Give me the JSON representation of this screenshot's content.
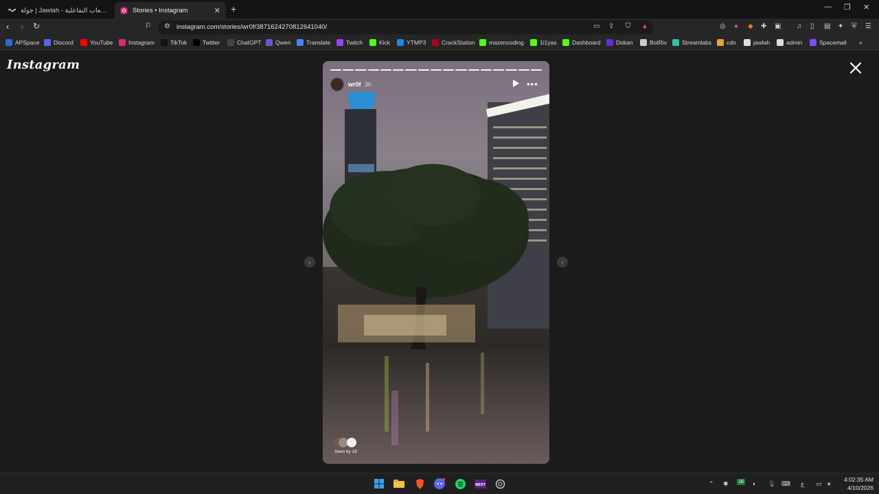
{
  "browser": {
    "tabs": [
      {
        "title": "جولة | Jawlah - منصة الألعاب التفاعلية",
        "favicon": "jawlah-icon",
        "active": false
      },
      {
        "title": "Stories • Instagram",
        "favicon": "instagram-icon",
        "active": true
      }
    ],
    "new_tab_label": "+",
    "url": "instagram.com/stories/wr0f/3871624270812641040/",
    "bookmarks": [
      {
        "label": "APSpace",
        "icon": "apspace-icon",
        "color": "#2b6cd4"
      },
      {
        "label": "Discord",
        "icon": "discord-icon",
        "color": "#5865f2"
      },
      {
        "label": "YouTube",
        "icon": "youtube-icon",
        "color": "#ff0000"
      },
      {
        "label": "Instagram",
        "icon": "instagram-icon",
        "color": "#d62976"
      },
      {
        "label": "TikTok",
        "icon": "tiktok-icon",
        "color": "#111111"
      },
      {
        "label": "Twitter",
        "icon": "x-icon",
        "color": "#000000"
      },
      {
        "label": "ChatGPT",
        "icon": "chatgpt-icon",
        "color": "#444444"
      },
      {
        "label": "Qwen",
        "icon": "qwen-icon",
        "color": "#6e56cf"
      },
      {
        "label": "Translate",
        "icon": "translate-icon",
        "color": "#4285f4"
      },
      {
        "label": "Twitch",
        "icon": "twitch-icon",
        "color": "#9146ff"
      },
      {
        "label": "Kick",
        "icon": "kick-icon",
        "color": "#53fc18"
      },
      {
        "label": "YTMP3",
        "icon": "ytmp3-icon",
        "color": "#1e88e5"
      },
      {
        "label": "CrackStation",
        "icon": "crackstation-icon",
        "color": "#b00020"
      },
      {
        "label": "mazencoding",
        "icon": "kick-icon",
        "color": "#53fc18"
      },
      {
        "label": "1i1yas",
        "icon": "kick-icon",
        "color": "#53fc18"
      },
      {
        "label": "Dashboard",
        "icon": "kick-icon",
        "color": "#53fc18"
      },
      {
        "label": "Dokan",
        "icon": "dokan-icon",
        "color": "#6b2bd9"
      },
      {
        "label": "BotRix",
        "icon": "botrix-icon",
        "color": "#cccccc"
      },
      {
        "label": "Streamlabs",
        "icon": "streamlabs-icon",
        "color": "#31c3a2"
      },
      {
        "label": "cdn",
        "icon": "cdn-icon",
        "color": "#e8a23a"
      },
      {
        "label": "jawlah",
        "icon": "jawlah-icon",
        "color": "#dddddd"
      },
      {
        "label": "admin",
        "icon": "jawlah-icon",
        "color": "#dddddd"
      },
      {
        "label": "Spacemail",
        "icon": "spacemail-icon",
        "color": "#7c4dff"
      }
    ]
  },
  "page": {
    "logo": "Instagram",
    "story": {
      "username": "wr0f",
      "time_ago": "3h",
      "segments_total": 17,
      "segment_current": 17,
      "seen_by": "Seen by 18"
    }
  },
  "taskbar": {
    "apps": [
      "windows-icon",
      "file-explorer-icon",
      "brave-icon",
      "discord-icon",
      "spotify-icon",
      "next-icon",
      "chatgpt-icon"
    ],
    "time": "4:02:35 AM",
    "date": "4/10/2026",
    "lang": "ع",
    "badge": "18"
  }
}
